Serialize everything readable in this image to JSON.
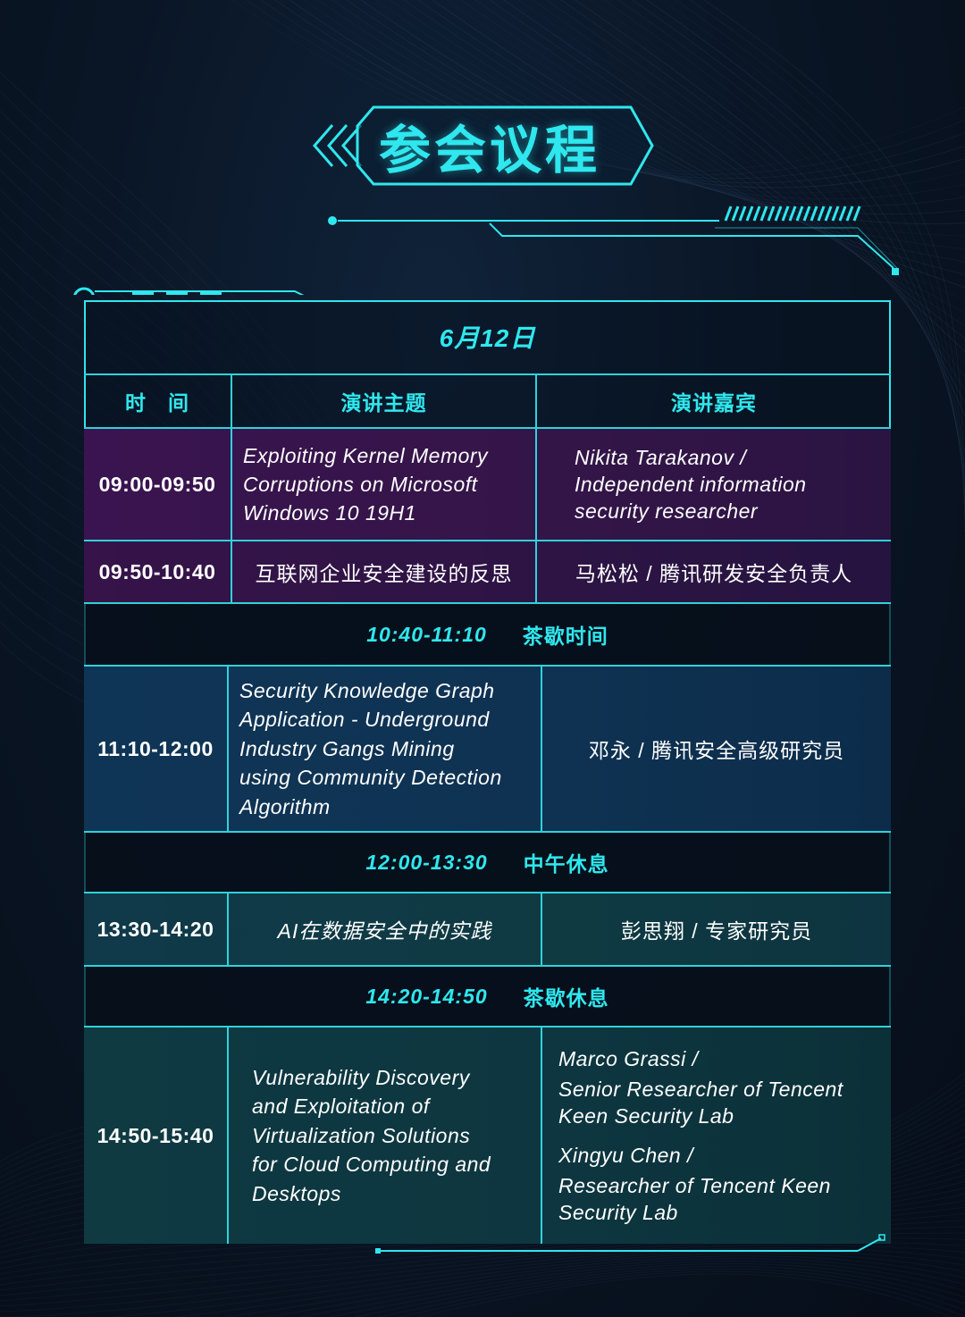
{
  "title": "参会议程",
  "date": "6月12日",
  "columns": {
    "time": "时　间",
    "topic": "演讲主题",
    "speaker": "演讲嘉宾"
  },
  "sessions": [
    {
      "time": "09:00-09:50",
      "topic": [
        "Exploiting Kernel Memory",
        "Corruptions on Microsoft",
        "Windows 10 19H1"
      ],
      "speaker": [
        "Nikita Tarakanov  /",
        "Independent information",
        "security researcher"
      ]
    },
    {
      "time": "09:50-10:40",
      "topic": [
        "互联网企业安全建设的反思"
      ],
      "speaker": [
        "马松松 / 腾讯研发安全负责人"
      ]
    },
    {
      "time": "11:10-12:00",
      "topic": [
        "Security Knowledge Graph",
        "Application - Underground",
        "Industry Gangs Mining",
        "using Community Detection",
        "Algorithm"
      ],
      "speaker": [
        "邓永 / 腾讯安全高级研究员"
      ]
    },
    {
      "time": "13:30-14:20",
      "topic": [
        "AI在数据安全中的实践"
      ],
      "speaker": [
        "彭思翔 / 专家研究员"
      ]
    },
    {
      "time": "14:50-15:40",
      "topic": [
        "Vulnerability Discovery",
        "and Exploitation of",
        "Virtualization Solutions",
        "for Cloud Computing and",
        "Desktops"
      ],
      "speaker": [
        "Marco Grassi  /",
        "Senior Researcher of Tencent",
        "Keen Security Lab",
        "Xingyu Chen  /",
        "Researcher of Tencent Keen",
        "Security Lab"
      ]
    }
  ],
  "breaks": [
    {
      "time": "10:40-11:10",
      "label": "茶歇时间"
    },
    {
      "time": "12:00-13:30",
      "label": "中午休息"
    },
    {
      "time": "14:20-14:50",
      "label": "茶歇休息"
    }
  ],
  "colors": {
    "accent": "#2fe7ee",
    "row_purple": "#3a1450",
    "row_blue": "#0f3556",
    "row_teal": "#0f3a42"
  }
}
